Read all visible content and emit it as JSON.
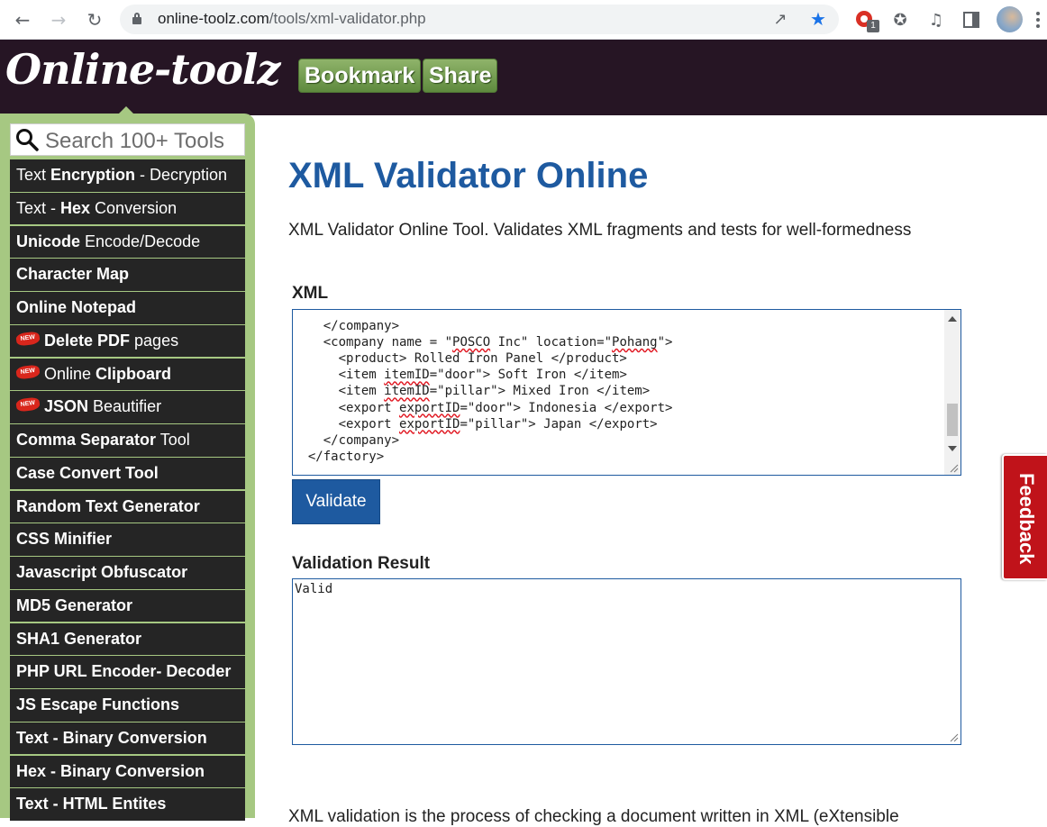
{
  "browser": {
    "url_host": "online-toolz.com",
    "url_path": "/tools/xml-validator.php",
    "extension_badge": "1"
  },
  "header": {
    "logo": "Online-toolz",
    "bookmark_label": "Bookmark",
    "share_label": "Share"
  },
  "sidebar": {
    "search_placeholder": "Search 100+ Tools",
    "items": [
      {
        "id": "text-encryption",
        "is_new": false,
        "parts": [
          [
            "Text ",
            false
          ],
          [
            "Encryption",
            true
          ],
          [
            " - Decryption",
            false
          ]
        ]
      },
      {
        "id": "text-hex",
        "is_new": false,
        "parts": [
          [
            "Text - ",
            false
          ],
          [
            "Hex",
            true
          ],
          [
            " Conversion",
            false
          ]
        ]
      },
      {
        "id": "unicode",
        "is_new": false,
        "parts": [
          [
            "Unicode",
            true
          ],
          [
            " Encode/Decode",
            false
          ]
        ]
      },
      {
        "id": "character-map",
        "is_new": false,
        "parts": [
          [
            "Character Map",
            true
          ]
        ]
      },
      {
        "id": "online-notepad",
        "is_new": false,
        "parts": [
          [
            "Online Notepad",
            true
          ]
        ]
      },
      {
        "id": "delete-pdf",
        "is_new": true,
        "parts": [
          [
            "Delete PDF",
            true
          ],
          [
            " pages",
            false
          ]
        ]
      },
      {
        "id": "online-clipboard",
        "is_new": true,
        "parts": [
          [
            "Online ",
            false
          ],
          [
            "Clipboard",
            true
          ]
        ]
      },
      {
        "id": "json-beautifier",
        "is_new": true,
        "parts": [
          [
            "JSON",
            true
          ],
          [
            " Beautifier",
            false
          ]
        ]
      },
      {
        "id": "comma-separator",
        "is_new": false,
        "parts": [
          [
            "Comma Separator",
            true
          ],
          [
            " Tool",
            false
          ]
        ]
      },
      {
        "id": "case-convert",
        "is_new": false,
        "parts": [
          [
            "Case Convert Tool",
            true
          ]
        ]
      },
      {
        "id": "random-text",
        "is_new": false,
        "parts": [
          [
            "Random Text Generator",
            true
          ]
        ]
      },
      {
        "id": "css-minifier",
        "is_new": false,
        "parts": [
          [
            "CSS Minifier",
            true
          ]
        ]
      },
      {
        "id": "js-obfuscator",
        "is_new": false,
        "parts": [
          [
            "Javascript Obfuscator",
            true
          ]
        ]
      },
      {
        "id": "md5",
        "is_new": false,
        "parts": [
          [
            "MD5 Generator",
            true
          ]
        ]
      },
      {
        "id": "sha1",
        "is_new": false,
        "parts": [
          [
            "SHA1 Generator",
            true
          ]
        ]
      },
      {
        "id": "php-url",
        "is_new": false,
        "parts": [
          [
            "PHP URL Encoder- Decoder",
            true
          ]
        ]
      },
      {
        "id": "js-escape",
        "is_new": false,
        "parts": [
          [
            "JS Escape Functions",
            true
          ]
        ]
      },
      {
        "id": "text-binary",
        "is_new": false,
        "parts": [
          [
            "Text - Binary Conversion",
            true
          ]
        ]
      },
      {
        "id": "hex-binary",
        "is_new": false,
        "parts": [
          [
            "Hex - Binary Conversion",
            true
          ]
        ]
      },
      {
        "id": "text-html",
        "is_new": false,
        "parts": [
          [
            "Text - HTML Entites",
            true
          ]
        ]
      }
    ],
    "new_badge": "NEW"
  },
  "main": {
    "title": "XML Validator Online",
    "description": "XML Validator Online Tool. Validates XML fragments and tests for well-formedness",
    "xml_label": "XML",
    "xml_lines": [
      [
        [
          "    ",
          false
        ],
        [
          "          ",
          false
        ]
      ],
      [
        [
          "    </company>",
          false
        ]
      ],
      [
        [
          "    <company name = \"",
          false
        ],
        [
          "POSCO",
          true
        ],
        [
          " Inc\" location=\"",
          false
        ],
        [
          "Pohang",
          true
        ],
        [
          "\">",
          false
        ]
      ],
      [
        [
          "      <product> Rolled Iron Panel </product>",
          false
        ]
      ],
      [
        [
          "      <item ",
          false
        ],
        [
          "itemID",
          true
        ],
        [
          "=\"door\"> Soft Iron </item>",
          false
        ]
      ],
      [
        [
          "      <item ",
          false
        ],
        [
          "itemID",
          true
        ],
        [
          "=\"pillar\"> Mixed Iron </item>",
          false
        ]
      ],
      [
        [
          "      <export ",
          false
        ],
        [
          "exportID",
          true
        ],
        [
          "=\"door\"> Indonesia </export>",
          false
        ]
      ],
      [
        [
          "      <export ",
          false
        ],
        [
          "exportID",
          true
        ],
        [
          "=\"pillar\"> Japan </export>",
          false
        ]
      ],
      [
        [
          "    </company>",
          false
        ]
      ],
      [
        [
          "  </factory>",
          false
        ]
      ]
    ],
    "validate_label": "Validate",
    "result_label": "Validation Result",
    "result_value": "Valid",
    "bottom_text": "XML validation is the process of checking a document written in XML (eXtensible"
  },
  "feedback_label": "Feedback",
  "colors": {
    "header_bg": "#261524",
    "sidebar_bg": "#a6c882",
    "accent_blue": "#1e5aa0",
    "button_green": "#6f9a4c",
    "feedback_red": "#c0131a"
  }
}
